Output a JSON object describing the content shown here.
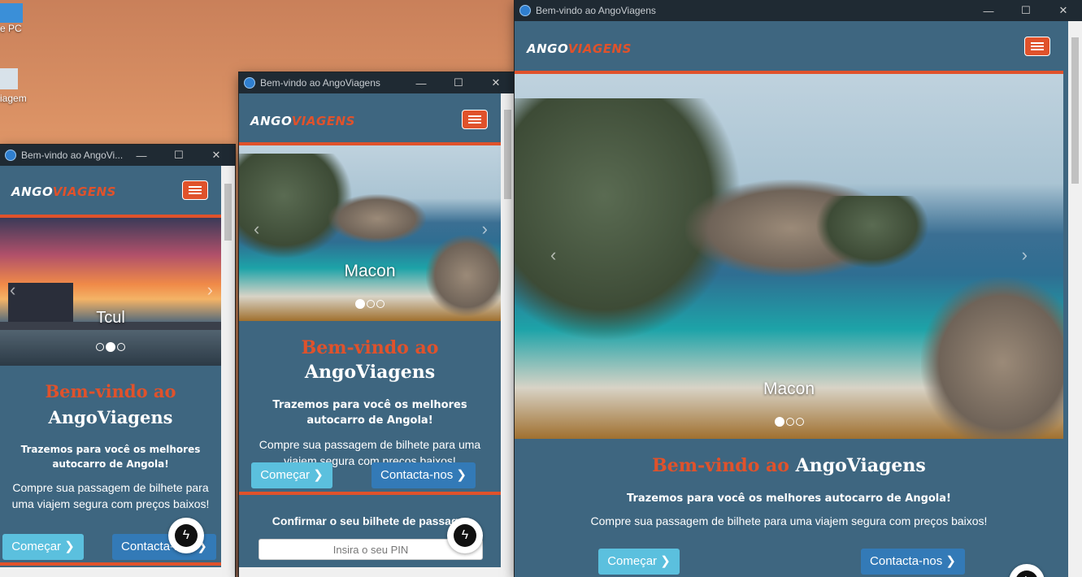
{
  "desktop": {
    "icons": [
      {
        "label": "e PC"
      },
      {
        "label": "iagem"
      }
    ]
  },
  "windows": [
    {
      "title": "Bem-vindo ao AngoVi...",
      "brand": {
        "part1": "ANGO",
        "part2": "VIAGENS"
      },
      "caption": "Tcul",
      "welcome": {
        "orange": "Bem-vindo ao",
        "white": "AngoViagens"
      },
      "tagline": "Trazemos para você os melhores autocarro de Angola!",
      "subtext": "Compre sua passagem de bilhete para uma viajem segura com preços baixos!",
      "btn_start": "Começar ❯",
      "btn_contact": "Contacta-nos ❯"
    },
    {
      "title": "Bem-vindo ao AngoViagens",
      "brand": {
        "part1": "ANGO",
        "part2": "VIAGENS"
      },
      "caption": "Macon",
      "welcome": {
        "orange": "Bem-vindo ao",
        "white": "AngoViagens"
      },
      "tagline": "Trazemos para você os melhores autocarro de Angola!",
      "subtext": "Compre sua passagem de bilhete para uma viajem segura com preços baixos!",
      "btn_start": "Começar ❯",
      "btn_contact": "Contacta-nos ❯",
      "confirm_title": "Confirmar o seu bilhete de passag...",
      "pin_placeholder": "Insira o seu PIN"
    },
    {
      "title": "Bem-vindo ao AngoViagens",
      "brand": {
        "part1": "ANGO",
        "part2": "VIAGENS"
      },
      "caption": "Macon",
      "welcome": {
        "orange": "Bem-vindo ao",
        "white": "AngoViagens"
      },
      "tagline": "Trazemos para você os melhores autocarro de Angola!",
      "subtext": "Compre sua passagem de bilhete para uma viajem segura com preços baixos!",
      "btn_start": "Começar ❯",
      "btn_contact": "Contacta-nos ❯"
    }
  ],
  "controls": {
    "minimize": "—",
    "maximize": "☐",
    "close": "✕",
    "prev": "‹",
    "next": "›",
    "messenger": "ϟ"
  }
}
